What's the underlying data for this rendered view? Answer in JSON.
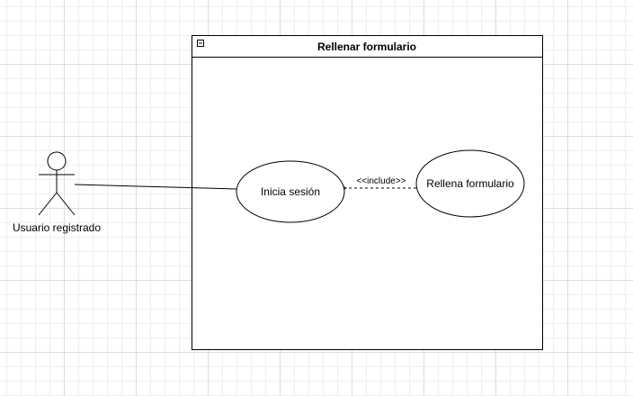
{
  "diagram": {
    "system_boundary": {
      "title": "Rellenar formulario",
      "collapse_icon": "minus-box-icon"
    },
    "actor": {
      "name": "Usuario registrado"
    },
    "use_cases": [
      {
        "label": "Inicia sesión"
      },
      {
        "label": "Rellena formulario"
      }
    ],
    "relationships": [
      {
        "type": "association",
        "from": "Usuario registrado",
        "to": "Inicia sesión"
      },
      {
        "type": "include",
        "stereotype": "<<include>>",
        "from": "Rellena formulario",
        "to": "Inicia sesión"
      }
    ]
  }
}
